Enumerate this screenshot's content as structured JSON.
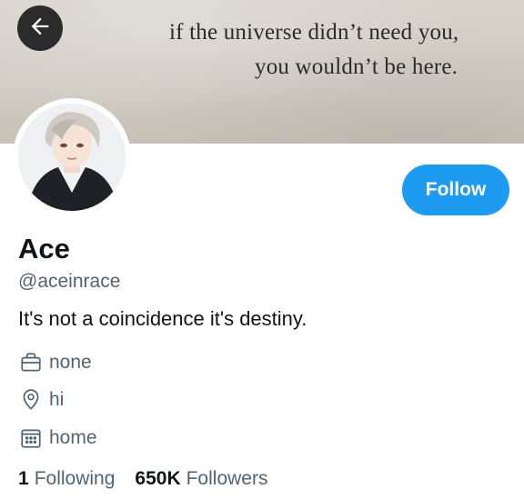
{
  "banner": {
    "quote_line1": "if the universe didn’t need you,",
    "quote_line2": "you wouldn’t be here."
  },
  "back_button": {
    "icon": "arrow-left-icon"
  },
  "profile": {
    "name": "Ace",
    "handle": "@aceinrace",
    "bio": "It's not a coincidence it's destiny.",
    "work": "none",
    "location": "hi",
    "website": "home"
  },
  "follow_button": {
    "label": "Follow"
  },
  "stats": {
    "following_count": "1",
    "following_label": "Following",
    "followers_count": "650K",
    "followers_label": "Followers"
  },
  "colors": {
    "accent": "#1d9bf0",
    "text_primary": "#0f1419",
    "text_secondary": "#536471",
    "back_button_bg": "#2b2b2b"
  }
}
